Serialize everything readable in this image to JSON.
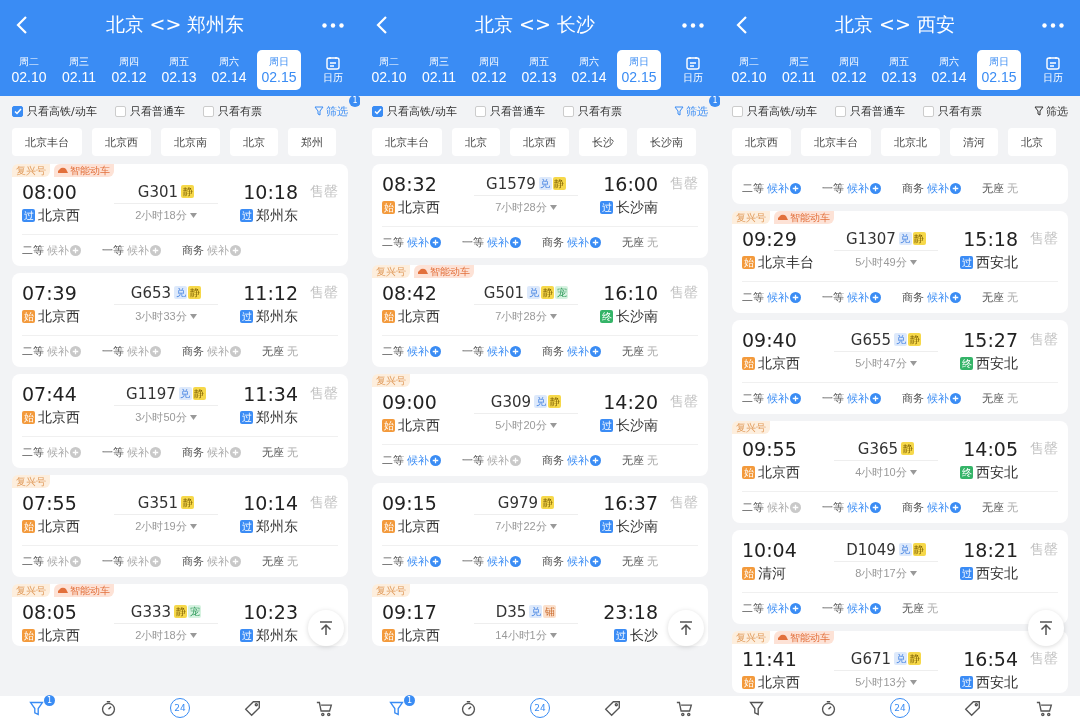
{
  "panels": [
    {
      "title": "北京 <> 郑州东",
      "dates": [
        {
          "weekday": "周二",
          "date": "02.10",
          "selected": false
        },
        {
          "weekday": "周三",
          "date": "02.11",
          "selected": false
        },
        {
          "weekday": "周四",
          "date": "02.12",
          "selected": false
        },
        {
          "weekday": "周五",
          "date": "02.13",
          "selected": false
        },
        {
          "weekday": "周六",
          "date": "02.14",
          "selected": false
        },
        {
          "weekday": "周日",
          "date": "02.15",
          "selected": true
        }
      ],
      "calendar": "日历",
      "filters": [
        {
          "label": "只看高铁/动车",
          "checked": true
        },
        {
          "label": "只看普通车",
          "checked": false
        },
        {
          "label": "只看有票",
          "checked": false
        }
      ],
      "filter_button": {
        "label": "筛选",
        "badge": "1"
      },
      "stations": [
        "北京丰台",
        "北京西",
        "北京南",
        "北京",
        "郑州"
      ],
      "trains": [
        {
          "tags": [
            {
              "text": "复兴号",
              "kind": "fuxing"
            },
            {
              "text": "智能动车",
              "kind": "smart"
            }
          ],
          "depart": "08:00",
          "number": "G301",
          "features": [
            {
              "text": "静",
              "kind": "quiet"
            }
          ],
          "arrive": "10:18",
          "from": {
            "badge": "过",
            "kind": "pass",
            "name": "北京西"
          },
          "duration": "2小时18分",
          "to": {
            "badge": "过",
            "kind": "pass",
            "name": "郑州东"
          },
          "status": "售罄",
          "seats": [
            {
              "class": "二等",
              "status": "候补",
              "kind": "waitlist",
              "active": false
            },
            {
              "class": "一等",
              "status": "候补",
              "kind": "waitlist",
              "active": false
            },
            {
              "class": "商务",
              "status": "候补",
              "kind": "waitlist",
              "active": false
            }
          ]
        },
        {
          "depart": "07:39",
          "number": "G653",
          "features": [
            {
              "text": "兑",
              "kind": "exchange"
            },
            {
              "text": "静",
              "kind": "quiet"
            }
          ],
          "arrive": "11:12",
          "from": {
            "badge": "始",
            "kind": "start",
            "name": "北京西"
          },
          "duration": "3小时33分",
          "to": {
            "badge": "过",
            "kind": "pass",
            "name": "郑州东"
          },
          "status": "售罄",
          "seats": [
            {
              "class": "二等",
              "status": "候补",
              "kind": "waitlist",
              "active": false
            },
            {
              "class": "一等",
              "status": "候补",
              "kind": "waitlist",
              "active": false
            },
            {
              "class": "商务",
              "status": "候补",
              "kind": "waitlist",
              "active": false
            },
            {
              "class": "无座",
              "status": "无",
              "kind": "none",
              "active": false
            }
          ]
        },
        {
          "depart": "07:44",
          "number": "G1197",
          "features": [
            {
              "text": "兑",
              "kind": "exchange"
            },
            {
              "text": "静",
              "kind": "quiet"
            }
          ],
          "arrive": "11:34",
          "from": {
            "badge": "始",
            "kind": "start",
            "name": "北京西"
          },
          "duration": "3小时50分",
          "to": {
            "badge": "过",
            "kind": "pass",
            "name": "郑州东"
          },
          "status": "售罄",
          "seats": [
            {
              "class": "二等",
              "status": "候补",
              "kind": "waitlist",
              "active": false
            },
            {
              "class": "一等",
              "status": "候补",
              "kind": "waitlist",
              "active": false
            },
            {
              "class": "商务",
              "status": "候补",
              "kind": "waitlist",
              "active": false
            },
            {
              "class": "无座",
              "status": "无",
              "kind": "none",
              "active": false
            }
          ]
        },
        {
          "tags": [
            {
              "text": "复兴号",
              "kind": "fuxing"
            }
          ],
          "depart": "07:55",
          "number": "G351",
          "features": [
            {
              "text": "静",
              "kind": "quiet"
            }
          ],
          "arrive": "10:14",
          "from": {
            "badge": "始",
            "kind": "start",
            "name": "北京西"
          },
          "duration": "2小时19分",
          "to": {
            "badge": "过",
            "kind": "pass",
            "name": "郑州东"
          },
          "status": "售罄",
          "seats": [
            {
              "class": "二等",
              "status": "候补",
              "kind": "waitlist",
              "active": false
            },
            {
              "class": "一等",
              "status": "候补",
              "kind": "waitlist",
              "active": false
            },
            {
              "class": "商务",
              "status": "候补",
              "kind": "waitlist",
              "active": false
            },
            {
              "class": "无座",
              "status": "无",
              "kind": "none",
              "active": false
            }
          ]
        },
        {
          "tags": [
            {
              "text": "复兴号",
              "kind": "fuxing"
            },
            {
              "text": "智能动车",
              "kind": "smart"
            }
          ],
          "depart": "08:05",
          "number": "G333",
          "features": [
            {
              "text": "静",
              "kind": "quiet"
            },
            {
              "text": "宠",
              "kind": "pet"
            }
          ],
          "arrive": "10:23",
          "from": {
            "badge": "始",
            "kind": "start",
            "name": "北京西"
          },
          "duration": "2小时18分",
          "to": {
            "badge": "过",
            "kind": "pass",
            "name": "郑州东"
          }
        }
      ],
      "nav": [
        {
          "kind": "filter",
          "active": true,
          "badge": "1"
        },
        {
          "kind": "timer",
          "active": false
        },
        {
          "kind": "day",
          "active": true,
          "label": "24"
        },
        {
          "kind": "tag",
          "active": false
        },
        {
          "kind": "cart",
          "active": false
        }
      ]
    },
    {
      "title": "北京 <> 长沙",
      "dates": [
        {
          "weekday": "周二",
          "date": "02.10",
          "selected": false
        },
        {
          "weekday": "周三",
          "date": "02.11",
          "selected": false
        },
        {
          "weekday": "周四",
          "date": "02.12",
          "selected": false
        },
        {
          "weekday": "周五",
          "date": "02.13",
          "selected": false
        },
        {
          "weekday": "周六",
          "date": "02.14",
          "selected": false
        },
        {
          "weekday": "周日",
          "date": "02.15",
          "selected": true
        }
      ],
      "calendar": "日历",
      "filters": [
        {
          "label": "只看高铁/动车",
          "checked": true
        },
        {
          "label": "只看普通车",
          "checked": false
        },
        {
          "label": "只看有票",
          "checked": false
        }
      ],
      "filter_button": {
        "label": "筛选",
        "badge": "1"
      },
      "stations": [
        "北京丰台",
        "北京",
        "北京西",
        "长沙",
        "长沙南"
      ],
      "trains": [
        {
          "depart": "08:32",
          "number": "G1579",
          "features": [
            {
              "text": "兑",
              "kind": "exchange"
            },
            {
              "text": "静",
              "kind": "quiet"
            }
          ],
          "arrive": "16:00",
          "from": {
            "badge": "始",
            "kind": "start",
            "name": "北京西"
          },
          "duration": "7小时28分",
          "to": {
            "badge": "过",
            "kind": "pass",
            "name": "长沙南"
          },
          "status": "售罄",
          "seats": [
            {
              "class": "二等",
              "status": "候补",
              "kind": "waitlist",
              "active": true
            },
            {
              "class": "一等",
              "status": "候补",
              "kind": "waitlist",
              "active": true
            },
            {
              "class": "商务",
              "status": "候补",
              "kind": "waitlist",
              "active": true
            },
            {
              "class": "无座",
              "status": "无",
              "kind": "none",
              "active": false
            }
          ]
        },
        {
          "tags": [
            {
              "text": "复兴号",
              "kind": "fuxing"
            },
            {
              "text": "智能动车",
              "kind": "smart"
            }
          ],
          "depart": "08:42",
          "number": "G501",
          "features": [
            {
              "text": "兑",
              "kind": "exchange"
            },
            {
              "text": "静",
              "kind": "quiet"
            },
            {
              "text": "宠",
              "kind": "pet"
            }
          ],
          "arrive": "16:10",
          "from": {
            "badge": "始",
            "kind": "start",
            "name": "北京西"
          },
          "duration": "7小时28分",
          "to": {
            "badge": "终",
            "kind": "end",
            "name": "长沙南"
          },
          "status": "售罄",
          "seats": [
            {
              "class": "二等",
              "status": "候补",
              "kind": "waitlist",
              "active": true
            },
            {
              "class": "一等",
              "status": "候补",
              "kind": "waitlist",
              "active": true
            },
            {
              "class": "商务",
              "status": "候补",
              "kind": "waitlist",
              "active": true
            },
            {
              "class": "无座",
              "status": "无",
              "kind": "none",
              "active": false
            }
          ]
        },
        {
          "tags": [
            {
              "text": "复兴号",
              "kind": "fuxing"
            }
          ],
          "depart": "09:00",
          "number": "G309",
          "features": [
            {
              "text": "兑",
              "kind": "exchange"
            },
            {
              "text": "静",
              "kind": "quiet"
            }
          ],
          "arrive": "14:20",
          "from": {
            "badge": "始",
            "kind": "start",
            "name": "北京西"
          },
          "duration": "5小时20分",
          "to": {
            "badge": "过",
            "kind": "pass",
            "name": "长沙南"
          },
          "status": "售罄",
          "seats": [
            {
              "class": "二等",
              "status": "候补",
              "kind": "waitlist",
              "active": true
            },
            {
              "class": "一等",
              "status": "候补",
              "kind": "waitlist",
              "active": false
            },
            {
              "class": "商务",
              "status": "候补",
              "kind": "waitlist",
              "active": true
            },
            {
              "class": "无座",
              "status": "无",
              "kind": "none",
              "active": false
            }
          ]
        },
        {
          "depart": "09:15",
          "number": "G979",
          "features": [
            {
              "text": "静",
              "kind": "quiet"
            }
          ],
          "arrive": "16:37",
          "from": {
            "badge": "始",
            "kind": "start",
            "name": "北京西"
          },
          "duration": "7小时22分",
          "to": {
            "badge": "过",
            "kind": "pass",
            "name": "长沙南"
          },
          "status": "售罄",
          "seats": [
            {
              "class": "二等",
              "status": "候补",
              "kind": "waitlist",
              "active": true
            },
            {
              "class": "一等",
              "status": "候补",
              "kind": "waitlist",
              "active": true
            },
            {
              "class": "商务",
              "status": "候补",
              "kind": "waitlist",
              "active": true
            },
            {
              "class": "无座",
              "status": "无",
              "kind": "none",
              "active": false
            }
          ]
        },
        {
          "tags": [
            {
              "text": "复兴号",
              "kind": "fuxing"
            }
          ],
          "depart": "09:17",
          "number": "D35",
          "features": [
            {
              "text": "兑",
              "kind": "exchange"
            },
            {
              "text": "铺",
              "kind": "sleeper"
            }
          ],
          "arrive": "23:18",
          "from": {
            "badge": "始",
            "kind": "start",
            "name": "北京西"
          },
          "duration": "14小时1分",
          "to": {
            "badge": "过",
            "kind": "pass",
            "name": "长沙"
          }
        }
      ],
      "nav": [
        {
          "kind": "filter",
          "active": true,
          "badge": "1"
        },
        {
          "kind": "timer",
          "active": false
        },
        {
          "kind": "day",
          "active": true,
          "label": "24"
        },
        {
          "kind": "tag",
          "active": false
        },
        {
          "kind": "cart",
          "active": false
        }
      ]
    },
    {
      "title": "北京 <> 西安",
      "dates": [
        {
          "weekday": "周二",
          "date": "02.10",
          "selected": false
        },
        {
          "weekday": "周三",
          "date": "02.11",
          "selected": false
        },
        {
          "weekday": "周四",
          "date": "02.12",
          "selected": false
        },
        {
          "weekday": "周五",
          "date": "02.13",
          "selected": false
        },
        {
          "weekday": "周六",
          "date": "02.14",
          "selected": false
        },
        {
          "weekday": "周日",
          "date": "02.15",
          "selected": true
        }
      ],
      "calendar": "日历",
      "filters": [
        {
          "label": "只看高铁/动车",
          "checked": false
        },
        {
          "label": "只看普通车",
          "checked": false
        },
        {
          "label": "只看有票",
          "checked": false
        }
      ],
      "filter_button": {
        "label": "筛选"
      },
      "stations": [
        "北京西",
        "北京丰台",
        "北京北",
        "清河",
        "北京"
      ],
      "trains": [
        {
          "seats": [
            {
              "class": "二等",
              "status": "候补",
              "kind": "waitlist",
              "active": true
            },
            {
              "class": "一等",
              "status": "候补",
              "kind": "waitlist",
              "active": true
            },
            {
              "class": "商务",
              "status": "候补",
              "kind": "waitlist",
              "active": true
            },
            {
              "class": "无座",
              "status": "无",
              "kind": "none",
              "active": false
            }
          ]
        },
        {
          "tags": [
            {
              "text": "复兴号",
              "kind": "fuxing"
            },
            {
              "text": "智能动车",
              "kind": "smart"
            }
          ],
          "depart": "09:29",
          "number": "G1307",
          "features": [
            {
              "text": "兑",
              "kind": "exchange"
            },
            {
              "text": "静",
              "kind": "quiet"
            }
          ],
          "arrive": "15:18",
          "from": {
            "badge": "始",
            "kind": "start",
            "name": "北京丰台"
          },
          "duration": "5小时49分",
          "to": {
            "badge": "过",
            "kind": "pass",
            "name": "西安北"
          },
          "status": "售罄",
          "seats": [
            {
              "class": "二等",
              "status": "候补",
              "kind": "waitlist",
              "active": true
            },
            {
              "class": "一等",
              "status": "候补",
              "kind": "waitlist",
              "active": true
            },
            {
              "class": "商务",
              "status": "候补",
              "kind": "waitlist",
              "active": true
            },
            {
              "class": "无座",
              "status": "无",
              "kind": "none",
              "active": false
            }
          ]
        },
        {
          "depart": "09:40",
          "number": "G655",
          "features": [
            {
              "text": "兑",
              "kind": "exchange"
            },
            {
              "text": "静",
              "kind": "quiet"
            }
          ],
          "arrive": "15:27",
          "from": {
            "badge": "始",
            "kind": "start",
            "name": "北京西"
          },
          "duration": "5小时47分",
          "to": {
            "badge": "终",
            "kind": "end",
            "name": "西安北"
          },
          "status": "售罄",
          "seats": [
            {
              "class": "二等",
              "status": "候补",
              "kind": "waitlist",
              "active": true
            },
            {
              "class": "一等",
              "status": "候补",
              "kind": "waitlist",
              "active": true
            },
            {
              "class": "商务",
              "status": "候补",
              "kind": "waitlist",
              "active": true
            },
            {
              "class": "无座",
              "status": "无",
              "kind": "none",
              "active": false
            }
          ]
        },
        {
          "tags": [
            {
              "text": "复兴号",
              "kind": "fuxing"
            }
          ],
          "depart": "09:55",
          "number": "G365",
          "features": [
            {
              "text": "静",
              "kind": "quiet"
            }
          ],
          "arrive": "14:05",
          "from": {
            "badge": "始",
            "kind": "start",
            "name": "北京西"
          },
          "duration": "4小时10分",
          "to": {
            "badge": "终",
            "kind": "end",
            "name": "西安北"
          },
          "status": "售罄",
          "seats": [
            {
              "class": "二等",
              "status": "候补",
              "kind": "waitlist",
              "active": false
            },
            {
              "class": "一等",
              "status": "候补",
              "kind": "waitlist",
              "active": true
            },
            {
              "class": "商务",
              "status": "候补",
              "kind": "waitlist",
              "active": true
            },
            {
              "class": "无座",
              "status": "无",
              "kind": "none",
              "active": false
            }
          ]
        },
        {
          "depart": "10:04",
          "number": "D1049",
          "features": [
            {
              "text": "兑",
              "kind": "exchange"
            },
            {
              "text": "静",
              "kind": "quiet"
            }
          ],
          "arrive": "18:21",
          "from": {
            "badge": "始",
            "kind": "start",
            "name": "清河"
          },
          "duration": "8小时17分",
          "to": {
            "badge": "过",
            "kind": "pass",
            "name": "西安北"
          },
          "status": "售罄",
          "seats": [
            {
              "class": "二等",
              "status": "候补",
              "kind": "waitlist",
              "active": true
            },
            {
              "class": "一等",
              "status": "候补",
              "kind": "waitlist",
              "active": true
            },
            {
              "class": "无座",
              "status": "无",
              "kind": "none",
              "active": false
            }
          ]
        },
        {
          "tags": [
            {
              "text": "复兴号",
              "kind": "fuxing"
            },
            {
              "text": "智能动车",
              "kind": "smart"
            }
          ],
          "depart": "11:41",
          "number": "G671",
          "features": [
            {
              "text": "兑",
              "kind": "exchange"
            },
            {
              "text": "静",
              "kind": "quiet"
            }
          ],
          "arrive": "16:54",
          "from": {
            "badge": "始",
            "kind": "start",
            "name": "北京西"
          },
          "duration": "5小时13分",
          "to": {
            "badge": "过",
            "kind": "pass",
            "name": "西安北"
          },
          "status": "售罄"
        }
      ],
      "nav": [
        {
          "kind": "filter",
          "active": false
        },
        {
          "kind": "timer",
          "active": false
        },
        {
          "kind": "day",
          "active": true,
          "label": "24"
        },
        {
          "kind": "tag",
          "active": false
        },
        {
          "kind": "cart",
          "active": false
        }
      ]
    }
  ]
}
